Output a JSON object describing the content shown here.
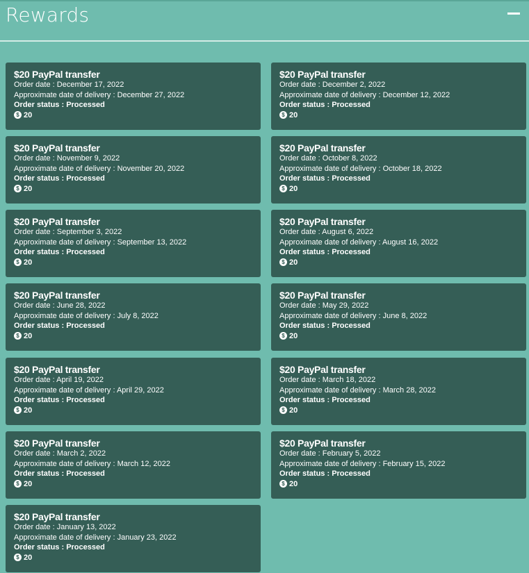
{
  "header": {
    "title": "Rewards",
    "collapse_icon": "minus-icon"
  },
  "labels": {
    "order_date": "Order date : ",
    "delivery": "Approximate date of delivery : ",
    "status": "Order status : "
  },
  "orders": [
    {
      "title": "$20 PayPal transfer",
      "order_date": "December 17, 2022",
      "delivery": "December 27, 2022",
      "status": "Processed",
      "points": "20"
    },
    {
      "title": "$20 PayPal transfer",
      "order_date": "December 2, 2022",
      "delivery": "December 12, 2022",
      "status": "Processed",
      "points": "20"
    },
    {
      "title": "$20 PayPal transfer",
      "order_date": "November 9, 2022",
      "delivery": "November 20, 2022",
      "status": "Processed",
      "points": "20"
    },
    {
      "title": "$20 PayPal transfer",
      "order_date": "October 8, 2022",
      "delivery": "October 18, 2022",
      "status": "Processed",
      "points": "20"
    },
    {
      "title": "$20 PayPal transfer",
      "order_date": "September 3, 2022",
      "delivery": "September 13, 2022",
      "status": "Processed",
      "points": "20"
    },
    {
      "title": "$20 PayPal transfer",
      "order_date": "August 6, 2022",
      "delivery": "August 16, 2022",
      "status": "Processed",
      "points": "20"
    },
    {
      "title": "$20 PayPal transfer",
      "order_date": "June 28, 2022",
      "delivery": "July 8, 2022",
      "status": "Processed",
      "points": "20"
    },
    {
      "title": "$20 PayPal transfer",
      "order_date": "May 29, 2022",
      "delivery": "June 8, 2022",
      "status": "Processed",
      "points": "20"
    },
    {
      "title": "$20 PayPal transfer",
      "order_date": "April 19, 2022",
      "delivery": "April 29, 2022",
      "status": "Processed",
      "points": "20"
    },
    {
      "title": "$20 PayPal transfer",
      "order_date": "March 18, 2022",
      "delivery": "March 28, 2022",
      "status": "Processed",
      "points": "20"
    },
    {
      "title": "$20 PayPal transfer",
      "order_date": "March 2, 2022",
      "delivery": "March 12, 2022",
      "status": "Processed",
      "points": "20"
    },
    {
      "title": "$20 PayPal transfer",
      "order_date": "February 5, 2022",
      "delivery": "February 15, 2022",
      "status": "Processed",
      "points": "20"
    },
    {
      "title": "$20 PayPal transfer",
      "order_date": "January 13, 2022",
      "delivery": "January 23, 2022",
      "status": "Processed",
      "points": "20"
    }
  ],
  "coin_symbol": "$",
  "colors": {
    "background": "#6fbcae",
    "card": "#355e56",
    "text": "#ffffff"
  }
}
